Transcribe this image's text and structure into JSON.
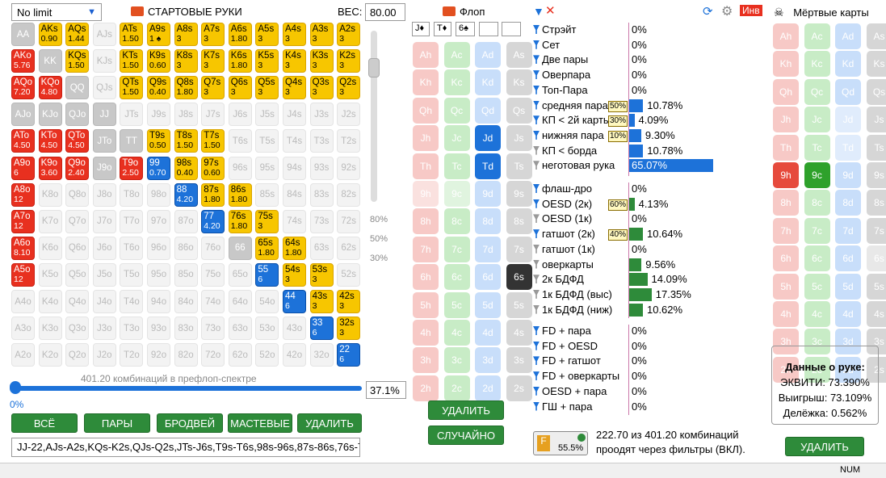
{
  "limit_select": "No limit",
  "range_title": "СТАРТОВЫЕ РУКИ",
  "weight_label": "ВЕС:",
  "weight_value": "80.00",
  "matrix": [
    [
      [
        "AA",
        "",
        "g"
      ],
      [
        "AKs",
        "0.90",
        "y"
      ],
      [
        "AQs",
        "1.44",
        "y"
      ],
      [
        "AJs",
        "",
        "e"
      ],
      [
        "ATs",
        "1.50",
        "y"
      ],
      [
        "A9s",
        "1 ♠",
        "y"
      ],
      [
        "A8s",
        "3",
        "y"
      ],
      [
        "A7s",
        "3",
        "y"
      ],
      [
        "A6s",
        "1.80",
        "y"
      ],
      [
        "A5s",
        "3",
        "y"
      ],
      [
        "A4s",
        "3",
        "y"
      ],
      [
        "A3s",
        "3",
        "y"
      ],
      [
        "A2s",
        "3",
        "y"
      ]
    ],
    [
      [
        "AKo",
        "5.76",
        "r"
      ],
      [
        "KK",
        "",
        "g"
      ],
      [
        "KQs",
        "1.50",
        "y"
      ],
      [
        "KJs",
        "",
        "e"
      ],
      [
        "KTs",
        "1.50",
        "y"
      ],
      [
        "K9s",
        "0.60",
        "y"
      ],
      [
        "K8s",
        "3",
        "y"
      ],
      [
        "K7s",
        "3",
        "y"
      ],
      [
        "K6s",
        "1.80",
        "y"
      ],
      [
        "K5s",
        "3",
        "y"
      ],
      [
        "K4s",
        "3",
        "y"
      ],
      [
        "K3s",
        "3",
        "y"
      ],
      [
        "K2s",
        "3",
        "y"
      ]
    ],
    [
      [
        "AQo",
        "7.20",
        "r"
      ],
      [
        "KQo",
        "4.80",
        "r"
      ],
      [
        "QQ",
        "",
        "g"
      ],
      [
        "QJs",
        "",
        "e"
      ],
      [
        "QTs",
        "1.50",
        "y"
      ],
      [
        "Q9s",
        "0.40",
        "y"
      ],
      [
        "Q8s",
        "1.80",
        "y"
      ],
      [
        "Q7s",
        "3",
        "y"
      ],
      [
        "Q6s",
        "3",
        "y"
      ],
      [
        "Q5s",
        "3",
        "y"
      ],
      [
        "Q4s",
        "3",
        "y"
      ],
      [
        "Q3s",
        "3",
        "y"
      ],
      [
        "Q2s",
        "3",
        "y"
      ]
    ],
    [
      [
        "AJo",
        "",
        "g"
      ],
      [
        "KJo",
        "",
        "g"
      ],
      [
        "QJo",
        "",
        "g"
      ],
      [
        "JJ",
        "",
        "g"
      ],
      [
        "JTs",
        "",
        "e"
      ],
      [
        "J9s",
        "",
        "e"
      ],
      [
        "J8s",
        "",
        "e"
      ],
      [
        "J7s",
        "",
        "e"
      ],
      [
        "J6s",
        "",
        "e"
      ],
      [
        "J5s",
        "",
        "e"
      ],
      [
        "J4s",
        "",
        "e"
      ],
      [
        "J3s",
        "",
        "e"
      ],
      [
        "J2s",
        "",
        "e"
      ]
    ],
    [
      [
        "ATo",
        "4.50",
        "r"
      ],
      [
        "KTo",
        "4.50",
        "r"
      ],
      [
        "QTo",
        "4.50",
        "r"
      ],
      [
        "JTo",
        "",
        "g"
      ],
      [
        "TT",
        "",
        "g"
      ],
      [
        "T9s",
        "0.50",
        "y"
      ],
      [
        "T8s",
        "1.50",
        "y"
      ],
      [
        "T7s",
        "1.50",
        "y"
      ],
      [
        "T6s",
        "",
        "e"
      ],
      [
        "T5s",
        "",
        "e"
      ],
      [
        "T4s",
        "",
        "e"
      ],
      [
        "T3s",
        "",
        "e"
      ],
      [
        "T2s",
        "",
        "e"
      ]
    ],
    [
      [
        "A9o",
        "6",
        "r"
      ],
      [
        "K9o",
        "3.60",
        "r"
      ],
      [
        "Q9o",
        "2.40",
        "r"
      ],
      [
        "J9o",
        "",
        "g"
      ],
      [
        "T9o",
        "2.50",
        "r"
      ],
      [
        "99",
        "0.70",
        "b"
      ],
      [
        "98s",
        "0.40",
        "y"
      ],
      [
        "97s",
        "0.60",
        "y"
      ],
      [
        "96s",
        "",
        "e"
      ],
      [
        "95s",
        "",
        "e"
      ],
      [
        "94s",
        "",
        "e"
      ],
      [
        "93s",
        "",
        "e"
      ],
      [
        "92s",
        "",
        "e"
      ]
    ],
    [
      [
        "A8o",
        "12",
        "r"
      ],
      [
        "K8o",
        "",
        "e"
      ],
      [
        "Q8o",
        "",
        "e"
      ],
      [
        "J8o",
        "",
        "e"
      ],
      [
        "T8o",
        "",
        "e"
      ],
      [
        "98o",
        "",
        "e"
      ],
      [
        "88",
        "4.20",
        "b"
      ],
      [
        "87s",
        "1.80",
        "y"
      ],
      [
        "86s",
        "1.80",
        "y"
      ],
      [
        "85s",
        "",
        "e"
      ],
      [
        "84s",
        "",
        "e"
      ],
      [
        "83s",
        "",
        "e"
      ],
      [
        "82s",
        "",
        "e"
      ]
    ],
    [
      [
        "A7o",
        "12",
        "r"
      ],
      [
        "K7o",
        "",
        "e"
      ],
      [
        "Q7o",
        "",
        "e"
      ],
      [
        "J7o",
        "",
        "e"
      ],
      [
        "T7o",
        "",
        "e"
      ],
      [
        "97o",
        "",
        "e"
      ],
      [
        "87o",
        "",
        "e"
      ],
      [
        "77",
        "4.20",
        "b"
      ],
      [
        "76s",
        "1.80",
        "y"
      ],
      [
        "75s",
        "3",
        "y"
      ],
      [
        "74s",
        "",
        "e"
      ],
      [
        "73s",
        "",
        "e"
      ],
      [
        "72s",
        "",
        "e"
      ]
    ],
    [
      [
        "A6o",
        "8.10",
        "r"
      ],
      [
        "K6o",
        "",
        "e"
      ],
      [
        "Q6o",
        "",
        "e"
      ],
      [
        "J6o",
        "",
        "e"
      ],
      [
        "T6o",
        "",
        "e"
      ],
      [
        "96o",
        "",
        "e"
      ],
      [
        "86o",
        "",
        "e"
      ],
      [
        "76o",
        "",
        "e"
      ],
      [
        "66",
        "",
        "g"
      ],
      [
        "65s",
        "1.80",
        "y"
      ],
      [
        "64s",
        "1.80",
        "y"
      ],
      [
        "63s",
        "",
        "e"
      ],
      [
        "62s",
        "",
        "e"
      ]
    ],
    [
      [
        "A5o",
        "12",
        "r"
      ],
      [
        "K5o",
        "",
        "e"
      ],
      [
        "Q5o",
        "",
        "e"
      ],
      [
        "J5o",
        "",
        "e"
      ],
      [
        "T5o",
        "",
        "e"
      ],
      [
        "95o",
        "",
        "e"
      ],
      [
        "85o",
        "",
        "e"
      ],
      [
        "75o",
        "",
        "e"
      ],
      [
        "65o",
        "",
        "e"
      ],
      [
        "55",
        "6",
        "b"
      ],
      [
        "54s",
        "3",
        "y"
      ],
      [
        "53s",
        "3",
        "y"
      ],
      [
        "52s",
        "",
        "e"
      ]
    ],
    [
      [
        "A4o",
        "",
        "e"
      ],
      [
        "K4o",
        "",
        "e"
      ],
      [
        "Q4o",
        "",
        "e"
      ],
      [
        "J4o",
        "",
        "e"
      ],
      [
        "T4o",
        "",
        "e"
      ],
      [
        "94o",
        "",
        "e"
      ],
      [
        "84o",
        "",
        "e"
      ],
      [
        "74o",
        "",
        "e"
      ],
      [
        "64o",
        "",
        "e"
      ],
      [
        "54o",
        "",
        "e"
      ],
      [
        "44",
        "6",
        "b"
      ],
      [
        "43s",
        "3",
        "y"
      ],
      [
        "42s",
        "3",
        "y"
      ]
    ],
    [
      [
        "A3o",
        "",
        "e"
      ],
      [
        "K3o",
        "",
        "e"
      ],
      [
        "Q3o",
        "",
        "e"
      ],
      [
        "J3o",
        "",
        "e"
      ],
      [
        "T3o",
        "",
        "e"
      ],
      [
        "93o",
        "",
        "e"
      ],
      [
        "83o",
        "",
        "e"
      ],
      [
        "73o",
        "",
        "e"
      ],
      [
        "63o",
        "",
        "e"
      ],
      [
        "53o",
        "",
        "e"
      ],
      [
        "43o",
        "",
        "e"
      ],
      [
        "33",
        "6",
        "b"
      ],
      [
        "32s",
        "3",
        "y"
      ]
    ],
    [
      [
        "A2o",
        "",
        "e"
      ],
      [
        "K2o",
        "",
        "e"
      ],
      [
        "Q2o",
        "",
        "e"
      ],
      [
        "J2o",
        "",
        "e"
      ],
      [
        "T2o",
        "",
        "e"
      ],
      [
        "92o",
        "",
        "e"
      ],
      [
        "82o",
        "",
        "e"
      ],
      [
        "72o",
        "",
        "e"
      ],
      [
        "62o",
        "",
        "e"
      ],
      [
        "52o",
        "",
        "e"
      ],
      [
        "42o",
        "",
        "e"
      ],
      [
        "32o",
        "",
        "e"
      ],
      [
        "22",
        "6",
        "b"
      ]
    ]
  ],
  "slider_marks": [
    "80%",
    "50%",
    "30%"
  ],
  "combos_text": "401.20 комбинаций в префлоп-спектре",
  "slider_zero": "0%",
  "slider_pct": "37.1%",
  "buttons": {
    "all": "ВСЁ",
    "pairs": "ПАРЫ",
    "broadway": "БРОДВЕЙ",
    "suited": "МАСТЕВЫЕ",
    "delete": "УДАЛИТЬ"
  },
  "range_string": "JJ-22,AJs-A2s,KQs-K2s,QJs-Q2s,JTs-J6s,T9s-T6s,98s-96s,87s-86s,76s-7",
  "flop_title": "Флоп",
  "flop_cards": [
    "J♦",
    "T♦",
    "6♠"
  ],
  "flop_grid": [
    [
      [
        "Ah",
        "h"
      ],
      [
        "Ac",
        "c"
      ],
      [
        "Ad",
        "d"
      ],
      [
        "As",
        "s"
      ]
    ],
    [
      [
        "Kh",
        "h"
      ],
      [
        "Kc",
        "c"
      ],
      [
        "Kd",
        "d"
      ],
      [
        "Ks",
        "s"
      ]
    ],
    [
      [
        "Qh",
        "h"
      ],
      [
        "Qc",
        "c"
      ],
      [
        "Qd",
        "d"
      ],
      [
        "Qs",
        "s"
      ]
    ],
    [
      [
        "Jh",
        "h"
      ],
      [
        "Jc",
        "c"
      ],
      [
        "Jd",
        "dd"
      ],
      [
        "Js",
        "s"
      ]
    ],
    [
      [
        "Th",
        "h"
      ],
      [
        "Tc",
        "c"
      ],
      [
        "Td",
        "dd"
      ],
      [
        "Ts",
        "s"
      ]
    ],
    [
      [
        "9h",
        "hf"
      ],
      [
        "9c",
        "cf"
      ],
      [
        "9d",
        "d"
      ],
      [
        "9s",
        "s"
      ]
    ],
    [
      [
        "8h",
        "h"
      ],
      [
        "8c",
        "c"
      ],
      [
        "8d",
        "d"
      ],
      [
        "8s",
        "s"
      ]
    ],
    [
      [
        "7h",
        "h"
      ],
      [
        "7c",
        "c"
      ],
      [
        "7d",
        "d"
      ],
      [
        "7s",
        "s"
      ]
    ],
    [
      [
        "6h",
        "h"
      ],
      [
        "6c",
        "c"
      ],
      [
        "6d",
        "d"
      ],
      [
        "6s",
        "sd"
      ]
    ],
    [
      [
        "5h",
        "h"
      ],
      [
        "5c",
        "c"
      ],
      [
        "5d",
        "d"
      ],
      [
        "5s",
        "s"
      ]
    ],
    [
      [
        "4h",
        "h"
      ],
      [
        "4c",
        "c"
      ],
      [
        "4d",
        "d"
      ],
      [
        "4s",
        "s"
      ]
    ],
    [
      [
        "3h",
        "h"
      ],
      [
        "3c",
        "c"
      ],
      [
        "3d",
        "d"
      ],
      [
        "3s",
        "s"
      ]
    ],
    [
      [
        "2h",
        "h"
      ],
      [
        "2c",
        "c"
      ],
      [
        "2d",
        "d"
      ],
      [
        "2s",
        "s"
      ]
    ]
  ],
  "flop_buttons": {
    "delete": "УДАЛИТЬ",
    "random": "СЛУЧАЙНО"
  },
  "stats": [
    {
      "label": "Стрэйт",
      "val": "0%",
      "bar": 0,
      "c": "b",
      "f": 1
    },
    {
      "label": "Сет",
      "val": "0%",
      "bar": 0,
      "c": "b",
      "f": 1
    },
    {
      "label": "Две пары",
      "val": "0%",
      "bar": 0,
      "c": "b",
      "f": 1
    },
    {
      "label": "Оверпара",
      "val": "0%",
      "bar": 0,
      "c": "b",
      "f": 1
    },
    {
      "label": "Топ-Пара",
      "val": "0%",
      "bar": 0,
      "c": "b",
      "f": 1
    },
    {
      "label": "средняя пара",
      "val": "10.78%",
      "bar": 10.78,
      "c": "b",
      "f": 1,
      "tag": "50%"
    },
    {
      "label": "КП < 2й карты",
      "val": "4.09%",
      "bar": 4.09,
      "c": "b",
      "f": 1,
      "tag": "30%"
    },
    {
      "label": "нижняя пара",
      "val": "9.30%",
      "bar": 9.3,
      "c": "b",
      "f": 1,
      "tag": "10%"
    },
    {
      "label": "КП < борда",
      "val": "10.78%",
      "bar": 10.78,
      "c": "b",
      "f": 0
    },
    {
      "label": "неготовая рука",
      "val": "65.07%",
      "bar": 65.07,
      "c": "b",
      "f": 0
    },
    {
      "label": "флаш-дро",
      "val": "0%",
      "bar": 0,
      "c": "g",
      "f": 1
    },
    {
      "label": "OESD (2к)",
      "val": "4.13%",
      "bar": 4.13,
      "c": "g",
      "f": 1,
      "tag": "60%"
    },
    {
      "label": "OESD (1к)",
      "val": "0%",
      "bar": 0,
      "c": "g",
      "f": 0
    },
    {
      "label": "гатшот (2к)",
      "val": "10.64%",
      "bar": 10.64,
      "c": "g",
      "f": 1,
      "tag": "40%"
    },
    {
      "label": "гатшот (1к)",
      "val": "0%",
      "bar": 0,
      "c": "g",
      "f": 0
    },
    {
      "label": "оверкарты",
      "val": "9.56%",
      "bar": 9.56,
      "c": "g",
      "f": 0
    },
    {
      "label": "2к БДФД",
      "val": "14.09%",
      "bar": 14.09,
      "c": "g",
      "f": 0
    },
    {
      "label": "1к БДФД (выс)",
      "val": "17.35%",
      "bar": 17.35,
      "c": "g",
      "f": 0
    },
    {
      "label": "1к БДФД (ниж)",
      "val": "10.62%",
      "bar": 10.62,
      "c": "g",
      "f": 0
    },
    {
      "label": "FD + пара",
      "val": "0%",
      "bar": 0,
      "c": "b",
      "f": 1
    },
    {
      "label": "FD + OESD",
      "val": "0%",
      "bar": 0,
      "c": "b",
      "f": 1
    },
    {
      "label": "FD + гатшот",
      "val": "0%",
      "bar": 0,
      "c": "b",
      "f": 1
    },
    {
      "label": "FD + оверкарты",
      "val": "0%",
      "bar": 0,
      "c": "b",
      "f": 1
    },
    {
      "label": "OESD + пара",
      "val": "0%",
      "bar": 0,
      "c": "b",
      "f": 1
    },
    {
      "label": "ГШ + пара",
      "val": "0%",
      "bar": 0,
      "c": "b",
      "f": 1
    }
  ],
  "inv_label": "Инв",
  "filter_badge": "55.5%",
  "filter_summary_1": "222.70 из 401.20 комбинаций",
  "filter_summary_2": "проодят через фильтры (ВКЛ).",
  "dead_title": "Мёртвые карты",
  "dead_grid": [
    [
      [
        "Ah",
        "h"
      ],
      [
        "Ac",
        "c"
      ],
      [
        "Ad",
        "d"
      ],
      [
        "As",
        "s"
      ]
    ],
    [
      [
        "Kh",
        "h"
      ],
      [
        "Kc",
        "c"
      ],
      [
        "Kd",
        "d"
      ],
      [
        "Ks",
        "s"
      ]
    ],
    [
      [
        "Qh",
        "h"
      ],
      [
        "Qc",
        "c"
      ],
      [
        "Qd",
        "d"
      ],
      [
        "Qs",
        "s"
      ]
    ],
    [
      [
        "Jh",
        "h"
      ],
      [
        "Jc",
        "c"
      ],
      [
        "Jd",
        "df"
      ],
      [
        "Js",
        "s"
      ]
    ],
    [
      [
        "Th",
        "h"
      ],
      [
        "Tc",
        "c"
      ],
      [
        "Td",
        "df"
      ],
      [
        "Ts",
        "s"
      ]
    ],
    [
      [
        "9h",
        "hd"
      ],
      [
        "9c",
        "cd"
      ],
      [
        "9d",
        "d"
      ],
      [
        "9s",
        "s"
      ]
    ],
    [
      [
        "8h",
        "h"
      ],
      [
        "8c",
        "c"
      ],
      [
        "8d",
        "d"
      ],
      [
        "8s",
        "s"
      ]
    ],
    [
      [
        "7h",
        "h"
      ],
      [
        "7c",
        "c"
      ],
      [
        "7d",
        "d"
      ],
      [
        "7s",
        "s"
      ]
    ],
    [
      [
        "6h",
        "h"
      ],
      [
        "6c",
        "c"
      ],
      [
        "6d",
        "d"
      ],
      [
        "6s",
        "sf"
      ]
    ],
    [
      [
        "5h",
        "h"
      ],
      [
        "5c",
        "c"
      ],
      [
        "5d",
        "d"
      ],
      [
        "5s",
        "s"
      ]
    ],
    [
      [
        "4h",
        "h"
      ],
      [
        "4c",
        "c"
      ],
      [
        "4d",
        "d"
      ],
      [
        "4s",
        "s"
      ]
    ],
    [
      [
        "3h",
        "h"
      ],
      [
        "3c",
        "c"
      ],
      [
        "3d",
        "d"
      ],
      [
        "3s",
        "s"
      ]
    ],
    [
      [
        "2h",
        "h"
      ],
      [
        "2c",
        "c"
      ],
      [
        "2d",
        "d"
      ],
      [
        "2s",
        "s"
      ]
    ]
  ],
  "hand_box": {
    "title": "Данные о руке:",
    "equity": "ЭКВИТИ: 73.390%",
    "win": "Выигрыш: 73.109%",
    "split": "Делёжка: 0.562%"
  },
  "dead_delete": "УДАЛИТЬ",
  "status": "NUM"
}
